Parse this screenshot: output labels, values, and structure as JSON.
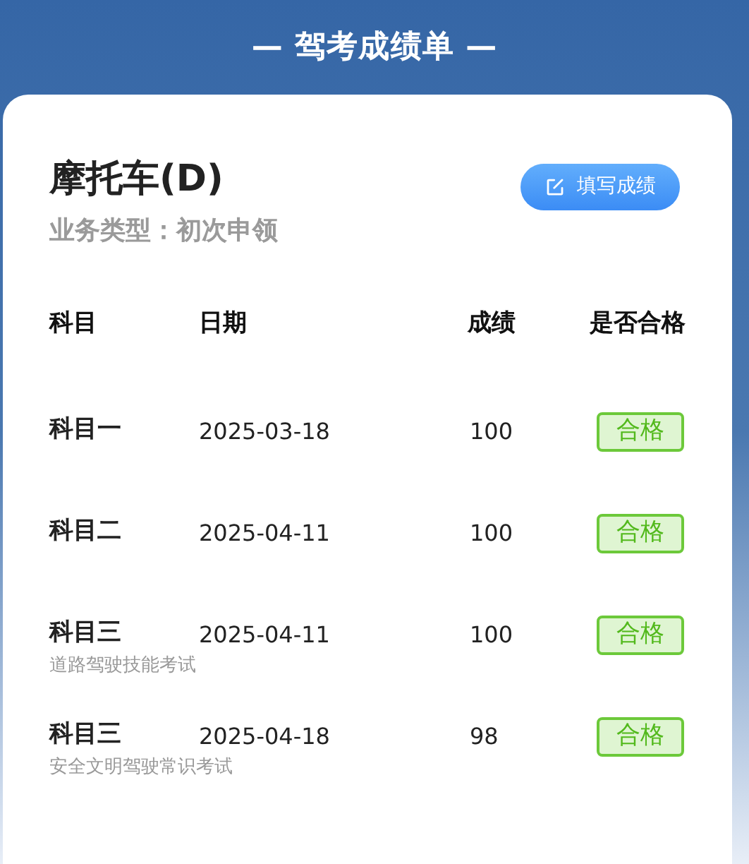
{
  "header": {
    "title": "— 驾考成绩单 —"
  },
  "card": {
    "vehicle": "摩托车(D)",
    "business_type": "业务类型：初次申领",
    "fill_button": "填写成绩"
  },
  "table": {
    "columns": [
      "科目",
      "日期",
      "成绩",
      "是否合格"
    ],
    "rows": [
      {
        "subject": "科目一",
        "date": "2025-03-18",
        "score": "100",
        "result": {
          "label": "合格",
          "passed": true
        }
      },
      {
        "subject": "科目二",
        "date": "2025-04-11",
        "score": "100",
        "result": {
          "label": "合格",
          "passed": true
        }
      },
      {
        "subject": "科目三",
        "note": "道路驾驶技能考试",
        "date": "2025-04-11",
        "score": "100",
        "result": {
          "label": "合格",
          "passed": true
        }
      },
      {
        "subject": "科目三",
        "note": "安全文明驾驶常识考试",
        "date": "2025-04-18",
        "score": "98",
        "result": {
          "label": "合格",
          "passed": true
        }
      }
    ]
  }
}
